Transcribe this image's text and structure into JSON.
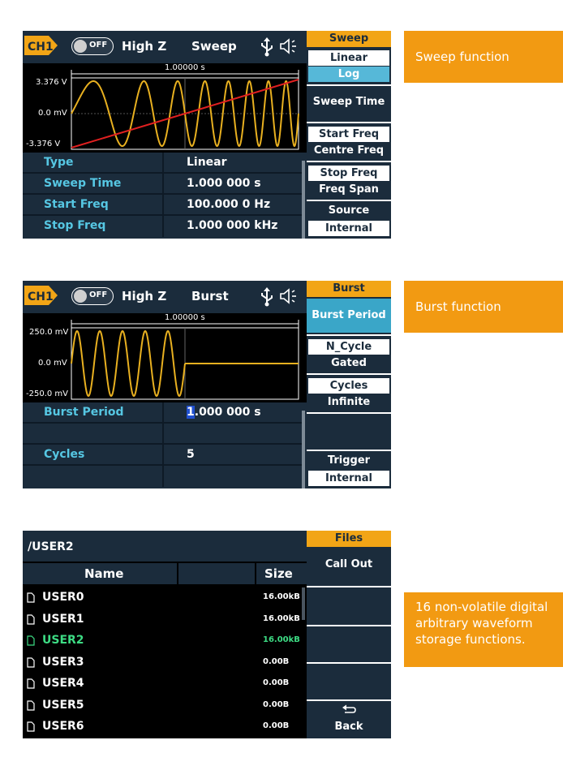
{
  "sweep": {
    "channel": "CH1",
    "output_state": "OFF",
    "impedance": "High Z",
    "mode": "Sweep",
    "timebase": "1.00000 s",
    "y_top": "3.376 V",
    "y_mid": "0.0 mV",
    "y_bot": "-3.376 V",
    "params": [
      {
        "label": "Type",
        "value": "Linear"
      },
      {
        "label": "Sweep Time",
        "value": "1.000 000 s"
      },
      {
        "label": "Start Freq",
        "value": "100.000 0 Hz"
      },
      {
        "label": "Stop Freq",
        "value": "1.000 000 kHz"
      }
    ],
    "menu": {
      "title": "Sweep",
      "linear": "Linear",
      "log": "Log",
      "sweep_time": "Sweep Time",
      "start_freq": "Start Freq",
      "centre_freq": "Centre Freq",
      "stop_freq": "Stop Freq",
      "freq_span": "Freq Span",
      "source": "Source",
      "internal": "Internal"
    },
    "callout": "Sweep function"
  },
  "burst": {
    "channel": "CH1",
    "output_state": "OFF",
    "impedance": "High Z",
    "mode": "Burst",
    "timebase": "1.00000 s",
    "y_top": "250.0 mV",
    "y_mid": "0.0 mV",
    "y_bot": "-250.0 mV",
    "params": [
      {
        "label": "Burst Period",
        "value_cursor": "1",
        "value_rest": ".000 000 s"
      },
      {
        "label": "",
        "value": ""
      },
      {
        "label": "Cycles",
        "value": "5"
      },
      {
        "label": "",
        "value": ""
      }
    ],
    "menu": {
      "title": "Burst",
      "burst_period": "Burst Period",
      "n_cycle": "N_Cycle",
      "gated": "Gated",
      "cycles": "Cycles",
      "infinite": "Infinite",
      "trigger": "Trigger",
      "internal": "Internal"
    },
    "callout": "Burst  function"
  },
  "files": {
    "path": "/USER2",
    "col_name": "Name",
    "col_size": "Size",
    "items": [
      {
        "name": "USER0",
        "size": "16.00kB"
      },
      {
        "name": "USER1",
        "size": "16.00kB"
      },
      {
        "name": "USER2",
        "size": "16.00kB"
      },
      {
        "name": "USER3",
        "size": "0.00B"
      },
      {
        "name": "USER4",
        "size": "0.00B"
      },
      {
        "name": "USER5",
        "size": "0.00B"
      },
      {
        "name": "USER6",
        "size": "0.00B"
      }
    ],
    "active_index": 2,
    "menu": {
      "title": "Files",
      "call_out": "Call Out",
      "back": "Back",
      "back_icon": "return-arrow-icon"
    },
    "callout": "16 non-volatile digital arbitrary waveform storage functions."
  },
  "colors": {
    "screen_bg": "#1b2c3c",
    "accent_orange": "#f2a516",
    "label_cyan": "#56c7e3",
    "waveform_yellow": "#e8b020",
    "sweep_line_red": "#e02020",
    "highlight_green": "#3ddc84"
  }
}
